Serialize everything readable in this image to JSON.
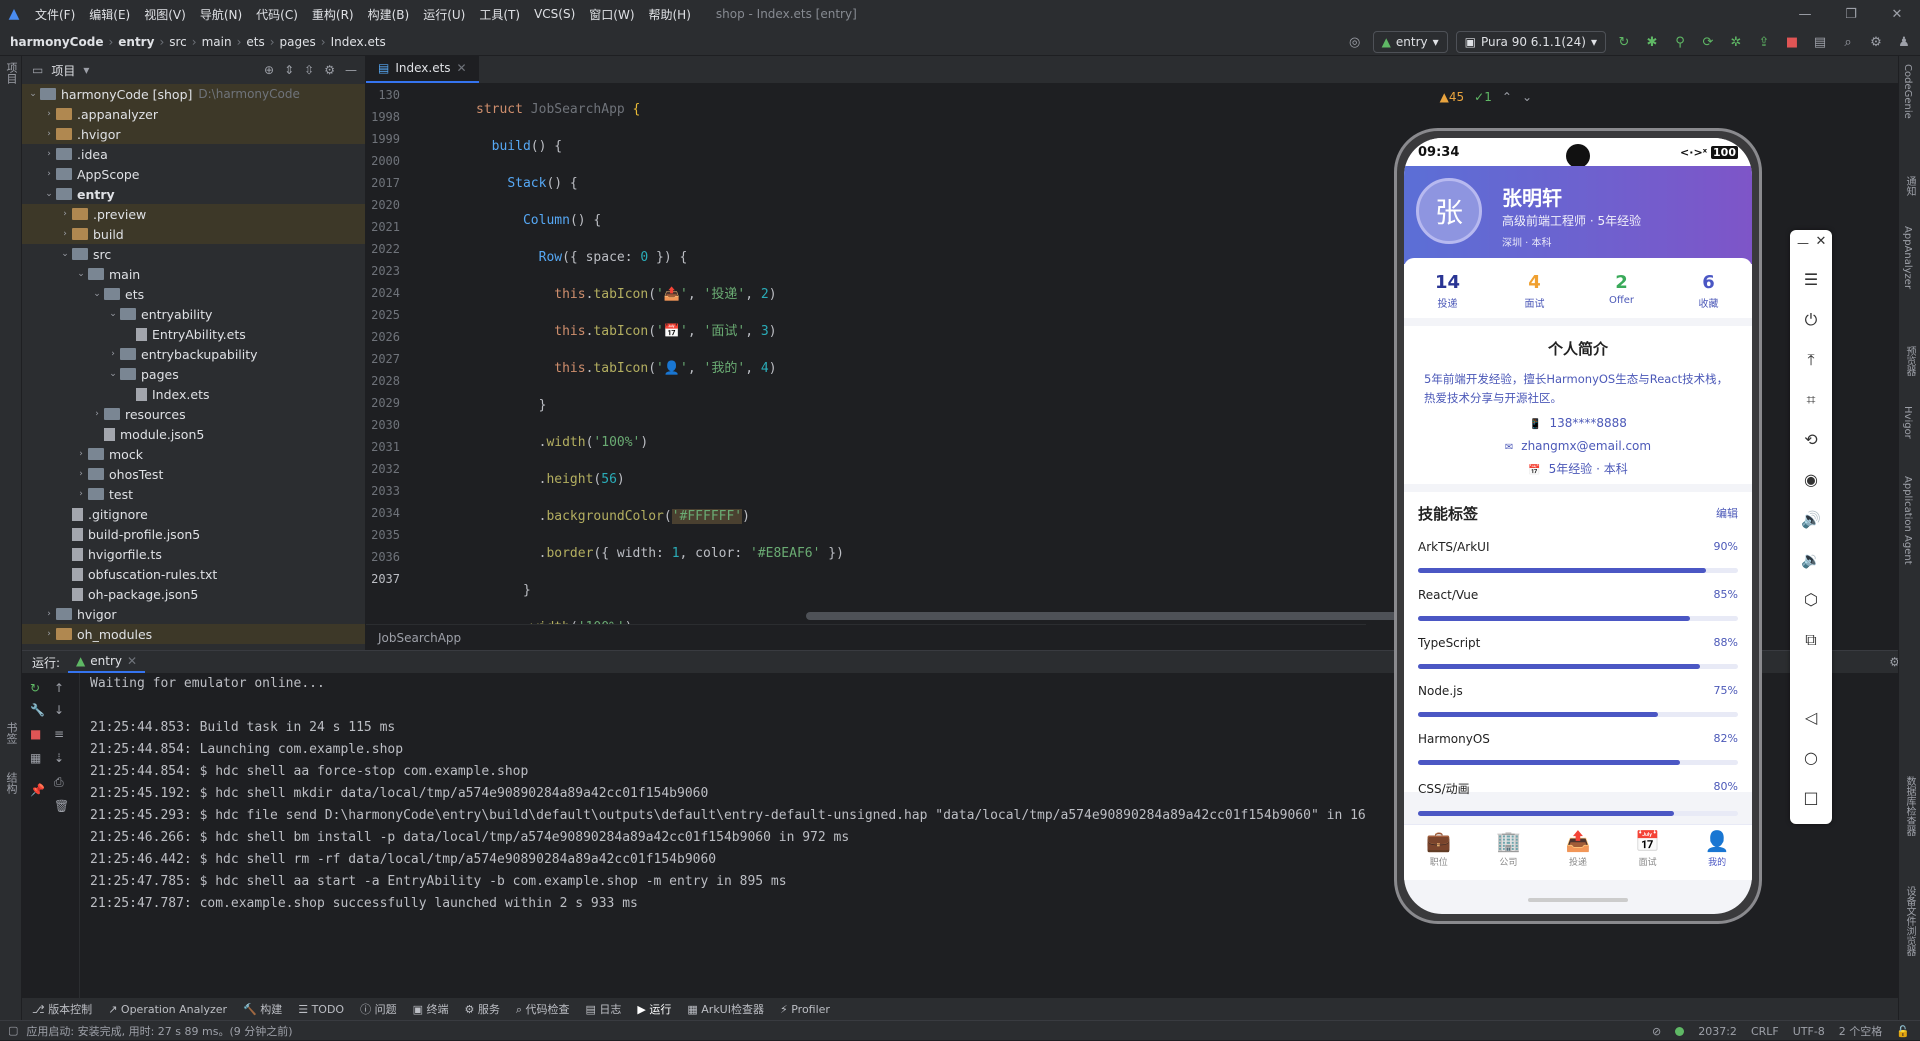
{
  "menu": {
    "items": [
      "文件(F)",
      "编辑(E)",
      "视图(V)",
      "导航(N)",
      "代码(C)",
      "重构(R)",
      "构建(B)",
      "运行(U)",
      "工具(T)",
      "VCS(S)",
      "窗口(W)",
      "帮助(H)"
    ],
    "window_title": "shop - Index.ets [entry]"
  },
  "breadcrumb": [
    "harmonyCode",
    "entry",
    "src",
    "main",
    "ets",
    "pages",
    "Index.ets"
  ],
  "toolbar": {
    "module": "entry",
    "device": "Pura 90 6.1.1(24)"
  },
  "project": {
    "header": "项目",
    "root_name": "harmonyCode [shop]",
    "root_path": "D:\\harmonyCode",
    "tree": [
      {
        "label": ".appanalyzer",
        "depth": 1,
        "type": "folder-o",
        "arrow": "›",
        "hl": true
      },
      {
        "label": ".hvigor",
        "depth": 1,
        "type": "folder-o",
        "arrow": "›",
        "hl": true
      },
      {
        "label": ".idea",
        "depth": 1,
        "type": "folder",
        "arrow": "›"
      },
      {
        "label": "AppScope",
        "depth": 1,
        "type": "folder",
        "arrow": "›"
      },
      {
        "label": "entry",
        "depth": 1,
        "type": "folder",
        "arrow": "⌄",
        "bold": true
      },
      {
        "label": ".preview",
        "depth": 2,
        "type": "folder-o",
        "arrow": "›",
        "hl": true
      },
      {
        "label": "build",
        "depth": 2,
        "type": "folder-o",
        "arrow": "›",
        "hl": true
      },
      {
        "label": "src",
        "depth": 2,
        "type": "folder",
        "arrow": "⌄"
      },
      {
        "label": "main",
        "depth": 3,
        "type": "folder",
        "arrow": "⌄"
      },
      {
        "label": "ets",
        "depth": 4,
        "type": "folder",
        "arrow": "⌄"
      },
      {
        "label": "entryability",
        "depth": 5,
        "type": "folder",
        "arrow": "⌄"
      },
      {
        "label": "EntryAbility.ets",
        "depth": 6,
        "type": "file",
        "arrow": ""
      },
      {
        "label": "entrybackupability",
        "depth": 5,
        "type": "folder",
        "arrow": "›"
      },
      {
        "label": "pages",
        "depth": 5,
        "type": "folder",
        "arrow": "⌄"
      },
      {
        "label": "Index.ets",
        "depth": 6,
        "type": "file",
        "arrow": ""
      },
      {
        "label": "resources",
        "depth": 4,
        "type": "folder",
        "arrow": "›"
      },
      {
        "label": "module.json5",
        "depth": 4,
        "type": "file",
        "arrow": ""
      },
      {
        "label": "mock",
        "depth": 3,
        "type": "folder",
        "arrow": "›"
      },
      {
        "label": "ohosTest",
        "depth": 3,
        "type": "folder",
        "arrow": "›"
      },
      {
        "label": "test",
        "depth": 3,
        "type": "folder",
        "arrow": "›"
      },
      {
        "label": ".gitignore",
        "depth": 2,
        "type": "file",
        "arrow": ""
      },
      {
        "label": "build-profile.json5",
        "depth": 2,
        "type": "file",
        "arrow": ""
      },
      {
        "label": "hvigorfile.ts",
        "depth": 2,
        "type": "file",
        "arrow": ""
      },
      {
        "label": "obfuscation-rules.txt",
        "depth": 2,
        "type": "file",
        "arrow": ""
      },
      {
        "label": "oh-package.json5",
        "depth": 2,
        "type": "file",
        "arrow": ""
      },
      {
        "label": "hvigor",
        "depth": 1,
        "type": "folder",
        "arrow": "›"
      },
      {
        "label": "oh_modules",
        "depth": 1,
        "type": "folder-o",
        "arrow": "›",
        "hl": true
      }
    ]
  },
  "editor": {
    "tab": "Index.ets",
    "inspection": {
      "warnings": "▲45",
      "ok": "✓1"
    },
    "footer": "JobSearchApp",
    "line_numbers": [
      "130",
      "1998",
      "1999",
      "2000",
      "2017",
      "2020",
      "2021",
      "2022",
      "2023",
      "2024",
      "2025",
      "2026",
      "2027",
      "2028",
      "2029",
      "2030",
      "2031",
      "2032",
      "2033",
      "2034",
      "2035",
      "2036",
      "2037"
    ]
  },
  "run": {
    "label": "运行:",
    "tab": "entry",
    "lines": [
      "Waiting for emulator online...",
      "",
      "21:25:44.853: Build task in 24 s 115 ms",
      "21:25:44.854: Launching com.example.shop",
      "21:25:44.854: $ hdc shell aa force-stop com.example.shop",
      "21:25:45.192: $ hdc shell mkdir data/local/tmp/a574e90890284a89a42cc01f154b9060",
      "21:25:45.293: $ hdc file send D:\\harmonyCode\\entry\\build\\default\\outputs\\default\\entry-default-unsigned.hap \"data/local/tmp/a574e90890284a89a42cc01f154b9060\" in 16",
      "21:25:46.266: $ hdc shell bm install -p data/local/tmp/a574e90890284a89a42cc01f154b9060 in 972 ms",
      "21:25:46.442: $ hdc shell rm -rf data/local/tmp/a574e90890284a89a42cc01f154b9060",
      "21:25:47.785: $ hdc shell aa start -a EntryAbility -b com.example.shop -m entry in 895 ms",
      "21:25:47.787: com.example.shop successfully launched within 2 s 933 ms"
    ]
  },
  "bottom_tabs": [
    "版本控制",
    "Operation Analyzer",
    "构建",
    "TODO",
    "问题",
    "终端",
    "服务",
    "代码检查",
    "日志",
    "运行",
    "ArkUI检查器",
    "Profiler"
  ],
  "status": {
    "left": "应用启动: 安装完成, 用时: 27 s 89 ms。(9 分钟之前)",
    "pos": "2037:2",
    "eol": "CRLF",
    "enc": "UTF-8",
    "indent": "2 个空格"
  },
  "left_vtabs": [
    "项目",
    "书签",
    "结构"
  ],
  "right_vtabs": [
    "CodeGenie",
    "通知",
    "AppAnalyzer",
    "预览器",
    "Hvigor",
    "Application Agent",
    "数据库检查器",
    "设备文件浏览器"
  ],
  "phone": {
    "time": "09:34",
    "battery": "100",
    "avatar": "张",
    "name": "张明轩",
    "title": "高级前端工程师 · 5年经验",
    "tags": "深圳 · 本科",
    "stats": [
      {
        "v": "14",
        "l": "投递",
        "c": "#2a3594"
      },
      {
        "v": "4",
        "l": "面试",
        "c": "#f0a030"
      },
      {
        "v": "2",
        "l": "Offer",
        "c": "#3aaa5a"
      },
      {
        "v": "6",
        "l": "收藏",
        "c": "#4b57c4"
      }
    ],
    "about_title": "个人简介",
    "about_desc": "5年前端开发经验，擅长HarmonyOS生态与React技术栈，热爱技术分享与开源社区。",
    "contacts": [
      {
        "icon": "📱",
        "text": "138****8888"
      },
      {
        "icon": "✉",
        "text": "zhangmx@email.com"
      },
      {
        "icon": "📅",
        "text": "5年经验 · 本科"
      }
    ],
    "skills_title": "技能标签",
    "skills_edit": "编辑",
    "skills": [
      {
        "name": "ArkTS/ArkUI",
        "pct": "90%",
        "v": 0.9
      },
      {
        "name": "React/Vue",
        "pct": "85%",
        "v": 0.85
      },
      {
        "name": "TypeScript",
        "pct": "88%",
        "v": 0.88
      },
      {
        "name": "Node.js",
        "pct": "75%",
        "v": 0.75
      },
      {
        "name": "HarmonyOS",
        "pct": "82%",
        "v": 0.82
      },
      {
        "name": "CSS/动画",
        "pct": "80%",
        "v": 0.8
      }
    ],
    "tabs": [
      {
        "icon": "💼",
        "label": "职位"
      },
      {
        "icon": "🏢",
        "label": "公司"
      },
      {
        "icon": "📤",
        "label": "投递"
      },
      {
        "icon": "📅",
        "label": "面试"
      },
      {
        "icon": "👤",
        "label": "我的"
      }
    ]
  },
  "colors": {
    "accent": "#3574f0",
    "brand_purple": "#7e55c8",
    "bar_fill": "#4b57c4"
  }
}
